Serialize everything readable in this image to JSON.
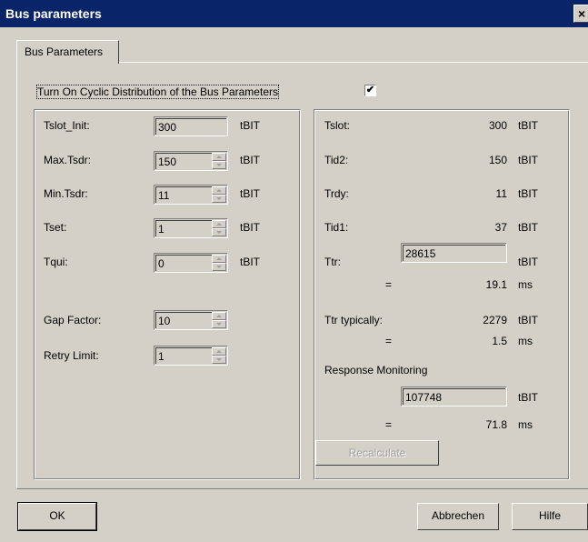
{
  "window": {
    "title": "Bus parameters",
    "close_glyph": "×"
  },
  "tab": {
    "label": "Bus Parameters"
  },
  "cyclic": {
    "label": "Turn On Cyclic Distribution of the Bus Parameters",
    "checked": true,
    "check_glyph": "✔"
  },
  "left": {
    "rows": [
      {
        "label": "Tslot_Init:",
        "value": "300",
        "unit": "tBIT"
      },
      {
        "label": "Max.Tsdr:",
        "value": "150",
        "unit": "tBIT"
      },
      {
        "label": "Min.Tsdr:",
        "value": "11",
        "unit": "tBIT"
      },
      {
        "label": "Tset:",
        "value": "1",
        "unit": "tBIT"
      },
      {
        "label": "Tqui:",
        "value": "0",
        "unit": "tBIT"
      }
    ],
    "gap_factor": {
      "label": "Gap Factor:",
      "value": "10"
    },
    "retry_limit": {
      "label": "Retry Limit:",
      "value": "1"
    }
  },
  "right": {
    "tslot": {
      "label": "Tslot:",
      "value": "300",
      "unit": "tBIT"
    },
    "tid2": {
      "label": "Tid2:",
      "value": "150",
      "unit": "tBIT"
    },
    "trdy": {
      "label": "Trdy:",
      "value": "11",
      "unit": "tBIT"
    },
    "tid1": {
      "label": "Tid1:",
      "value": "37",
      "unit": "tBIT"
    },
    "ttr": {
      "label": "Ttr:",
      "value": "28615",
      "unit": "tBIT",
      "eq": "=",
      "ms": "19.1",
      "ms_unit": "ms"
    },
    "ttr_typ": {
      "label": "Ttr typically:",
      "value": "2279",
      "unit": "tBIT",
      "eq": "=",
      "ms": "1.5",
      "ms_unit": "ms"
    },
    "resp": {
      "label": "Response Monitoring",
      "value": "107748",
      "unit": "tBIT",
      "eq": "=",
      "ms": "71.8",
      "ms_unit": "ms"
    },
    "recalc": "Recalculate"
  },
  "buttons": {
    "ok": "OK",
    "cancel": "Abbrechen",
    "help": "Hilfe"
  }
}
